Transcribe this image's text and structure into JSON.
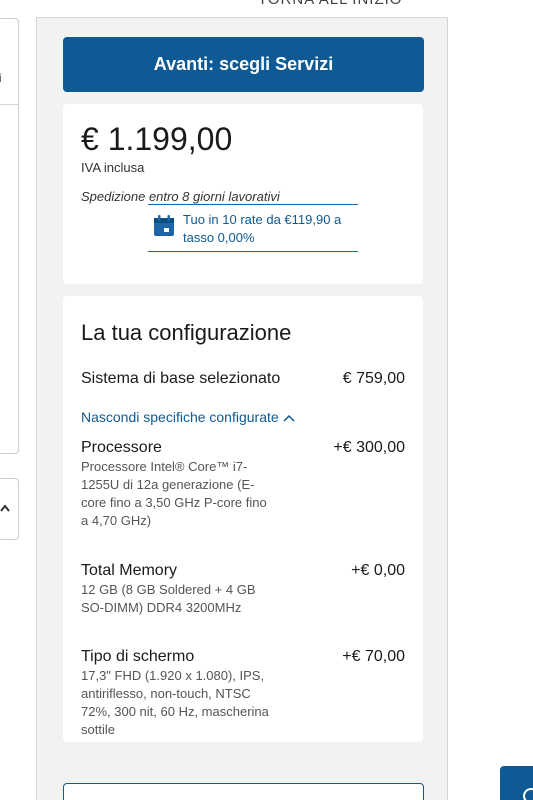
{
  "header": {
    "back_link": "TORNA ALL'INIZIO"
  },
  "left_panel": {
    "partial_text": "ri",
    "collapse_chevron": "chevron-up-icon"
  },
  "cta": {
    "label": "Avanti: scegli Servizi"
  },
  "price": {
    "amount": "€ 1.199,00",
    "vat": "IVA inclusa",
    "shipping": "Spedizione entro 8 giorni lavorativi",
    "installment_icon": "calendar-icon",
    "installment": "Tuo in 10 rate da €119,90 a tasso 0,00%"
  },
  "config": {
    "title": "La tua configurazione",
    "base": {
      "label": "Sistema di base selezionato",
      "price": "€ 759,00"
    },
    "toggle_label": "Nascondi specifiche configurate ",
    "items": [
      {
        "label": "Processore",
        "price": "+€ 300,00",
        "desc": "Processore Intel® Core™ i7-1255U di 12a generazione (E-core fino a 3,50 GHz P-core fino a 4,70 GHz)"
      },
      {
        "label": "Total Memory",
        "price": "+€ 0,00",
        "desc": "12 GB (8 GB Soldered + 4 GB SO-DIMM) DDR4 3200MHz"
      },
      {
        "label": "Tipo di schermo",
        "price": "+€ 70,00",
        "desc": "17,3\" FHD (1.920 x 1.080), IPS, antiriflesso, non-touch, NTSC 72%, 300 nit, 60 Hz, mascherina sottile"
      }
    ]
  },
  "colors": {
    "primary": "#0e5a94",
    "panel_bg": "#f2f2f2"
  }
}
